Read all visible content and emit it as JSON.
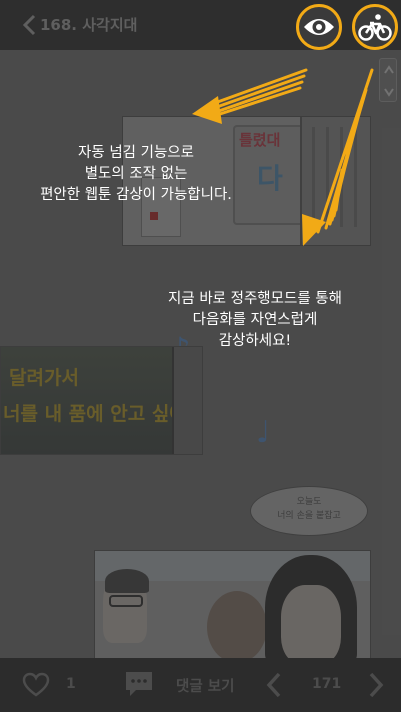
{
  "header": {
    "back_label": "<",
    "title": "168. 사각지대",
    "buttons": [
      {
        "name": "view-mode",
        "icon": "eye-icon"
      },
      {
        "name": "auto-scroll",
        "icon": "bicycle-icon"
      }
    ]
  },
  "tutorial": {
    "hint1_lines": [
      "자동 넘김 기능으로",
      "별도의 조작 없는",
      "편안한 웹툰 감상이 가능합니다."
    ],
    "hint2_lines": [
      "지금 바로 정주행모드를 통해",
      "다음화를 자연스럽게",
      "감상하세요!"
    ],
    "accent_color": "#f2aa16"
  },
  "comic": {
    "panel_top_sign_small": "틀렸대",
    "panel_top_sign_big": "다",
    "panel_mid_line1": "달려가서",
    "panel_mid_line2": "너를 내 품에 안고 싶어~",
    "bubble_lines": [
      "오늘도",
      "너의 손을 붙잡고"
    ]
  },
  "footer": {
    "like_icon": "heart-icon",
    "like_count": "1",
    "comment_icon": "comment-icon",
    "comment_label": "댓글 보기",
    "prev_icon": "chevron-left-icon",
    "page_number": "171",
    "next_icon": "chevron-right-icon"
  }
}
